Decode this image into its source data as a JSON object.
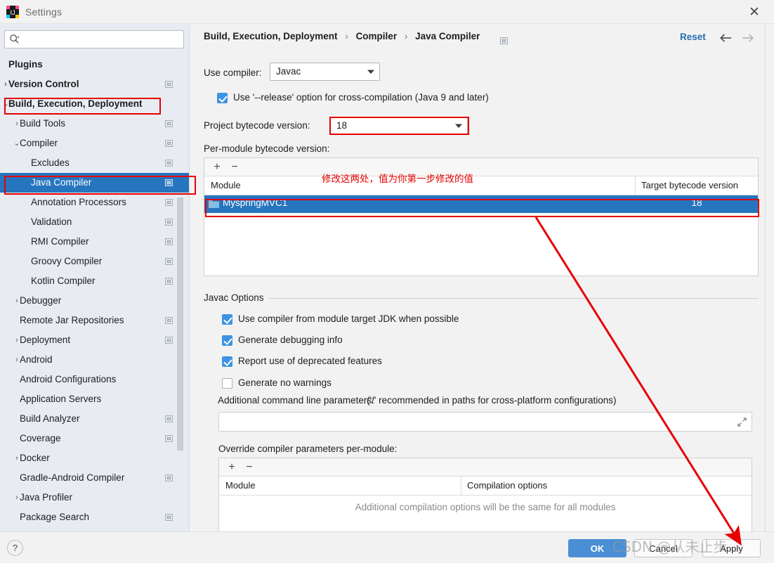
{
  "window": {
    "title": "Settings",
    "close_label": "✕",
    "app_icon": "intellij-idea-icon"
  },
  "sidebar": {
    "search": {
      "placeholder": "",
      "value": "",
      "icon": "search-icon"
    },
    "items": [
      {
        "label": "Plugins",
        "indent": 0,
        "arrow": "",
        "bold": true,
        "badge": false,
        "selected": false
      },
      {
        "label": "Version Control",
        "indent": 0,
        "arrow": "›",
        "bold": true,
        "badge": true,
        "selected": false
      },
      {
        "label": "Build, Execution, Deployment",
        "indent": 0,
        "arrow": "⌄",
        "bold": true,
        "badge": false,
        "selected": false
      },
      {
        "label": "Build Tools",
        "indent": 1,
        "arrow": "›",
        "bold": false,
        "badge": true,
        "selected": false
      },
      {
        "label": "Compiler",
        "indent": 1,
        "arrow": "⌄",
        "bold": false,
        "badge": true,
        "selected": false
      },
      {
        "label": "Excludes",
        "indent": 2,
        "arrow": "",
        "bold": false,
        "badge": true,
        "selected": false
      },
      {
        "label": "Java Compiler",
        "indent": 2,
        "arrow": "",
        "bold": false,
        "badge": true,
        "selected": true
      },
      {
        "label": "Annotation Processors",
        "indent": 2,
        "arrow": "",
        "bold": false,
        "badge": true,
        "selected": false
      },
      {
        "label": "Validation",
        "indent": 2,
        "arrow": "",
        "bold": false,
        "badge": true,
        "selected": false
      },
      {
        "label": "RMI Compiler",
        "indent": 2,
        "arrow": "",
        "bold": false,
        "badge": true,
        "selected": false
      },
      {
        "label": "Groovy Compiler",
        "indent": 2,
        "arrow": "",
        "bold": false,
        "badge": true,
        "selected": false
      },
      {
        "label": "Kotlin Compiler",
        "indent": 2,
        "arrow": "",
        "bold": false,
        "badge": true,
        "selected": false
      },
      {
        "label": "Debugger",
        "indent": 1,
        "arrow": "›",
        "bold": false,
        "badge": false,
        "selected": false
      },
      {
        "label": "Remote Jar Repositories",
        "indent": 1,
        "arrow": "",
        "bold": false,
        "badge": true,
        "selected": false
      },
      {
        "label": "Deployment",
        "indent": 1,
        "arrow": "›",
        "bold": false,
        "badge": true,
        "selected": false
      },
      {
        "label": "Android",
        "indent": 1,
        "arrow": "›",
        "bold": false,
        "badge": false,
        "selected": false
      },
      {
        "label": "Android Configurations",
        "indent": 1,
        "arrow": "",
        "bold": false,
        "badge": false,
        "selected": false
      },
      {
        "label": "Application Servers",
        "indent": 1,
        "arrow": "",
        "bold": false,
        "badge": false,
        "selected": false
      },
      {
        "label": "Build Analyzer",
        "indent": 1,
        "arrow": "",
        "bold": false,
        "badge": true,
        "selected": false
      },
      {
        "label": "Coverage",
        "indent": 1,
        "arrow": "",
        "bold": false,
        "badge": true,
        "selected": false
      },
      {
        "label": "Docker",
        "indent": 1,
        "arrow": "›",
        "bold": false,
        "badge": false,
        "selected": false
      },
      {
        "label": "Gradle-Android Compiler",
        "indent": 1,
        "arrow": "",
        "bold": false,
        "badge": true,
        "selected": false
      },
      {
        "label": "Java Profiler",
        "indent": 1,
        "arrow": "›",
        "bold": false,
        "badge": false,
        "selected": false
      },
      {
        "label": "Package Search",
        "indent": 1,
        "arrow": "",
        "bold": false,
        "badge": true,
        "selected": false
      }
    ]
  },
  "header": {
    "breadcrumbs": [
      "Build, Execution, Deployment",
      "Compiler",
      "Java Compiler"
    ],
    "separator": "›",
    "reset_label": "Reset",
    "back_icon": "arrow-left-icon",
    "forward_icon": "arrow-right-icon",
    "badge_icon": "settings-sync-badge-icon"
  },
  "main": {
    "use_compiler_label": "Use compiler:",
    "use_compiler_value": "Javac",
    "release_option_label": "Use '--release' option for cross-compilation (Java 9 and later)",
    "release_option_checked": true,
    "project_bytecode_label": "Project bytecode version:",
    "project_bytecode_value": "18",
    "per_module_label": "Per-module bytecode version:",
    "module_table": {
      "add_label": "+",
      "remove_label": "−",
      "columns": [
        "Module",
        "Target bytecode version"
      ],
      "rows": [
        {
          "module": "MyspringMVC1",
          "version": "18",
          "selected": true
        }
      ]
    },
    "javac_options": {
      "group_title": "Javac Options",
      "checkboxes": [
        {
          "label": "Use compiler from module target JDK when possible",
          "checked": true
        },
        {
          "label": "Generate debugging info",
          "checked": true
        },
        {
          "label": "Report use of deprecated features",
          "checked": true
        },
        {
          "label": "Generate no warnings",
          "checked": false
        }
      ],
      "additional_params_label": "Additional command line parameters:",
      "additional_params_hint": "('/' recommended in paths for cross-platform configurations)",
      "additional_params_value": "",
      "expand_icon": "expand-icon"
    },
    "override_section": {
      "label": "Override compiler parameters per-module:",
      "add_label": "+",
      "remove_label": "−",
      "columns": [
        "Module",
        "Compilation options"
      ],
      "empty_message": "Additional compilation options will be the same for all modules"
    }
  },
  "footer": {
    "help_label": "?",
    "ok_label": "OK",
    "cancel_label": "Cancel",
    "apply_label": "Apply"
  },
  "annotations": {
    "note_text": "修改这两处，值为你第一步修改的值",
    "highlight_color": "#e60000",
    "arrow_color": "#e60000",
    "watermark_text": "CSDN @从未止步.."
  },
  "colors": {
    "selection_blue": "#2675bf",
    "accent_blue": "#4a8fd4",
    "link_blue": "#2470b3",
    "sidebar_bg": "#e8ecf2",
    "panel_bg": "#f2f2f2"
  }
}
